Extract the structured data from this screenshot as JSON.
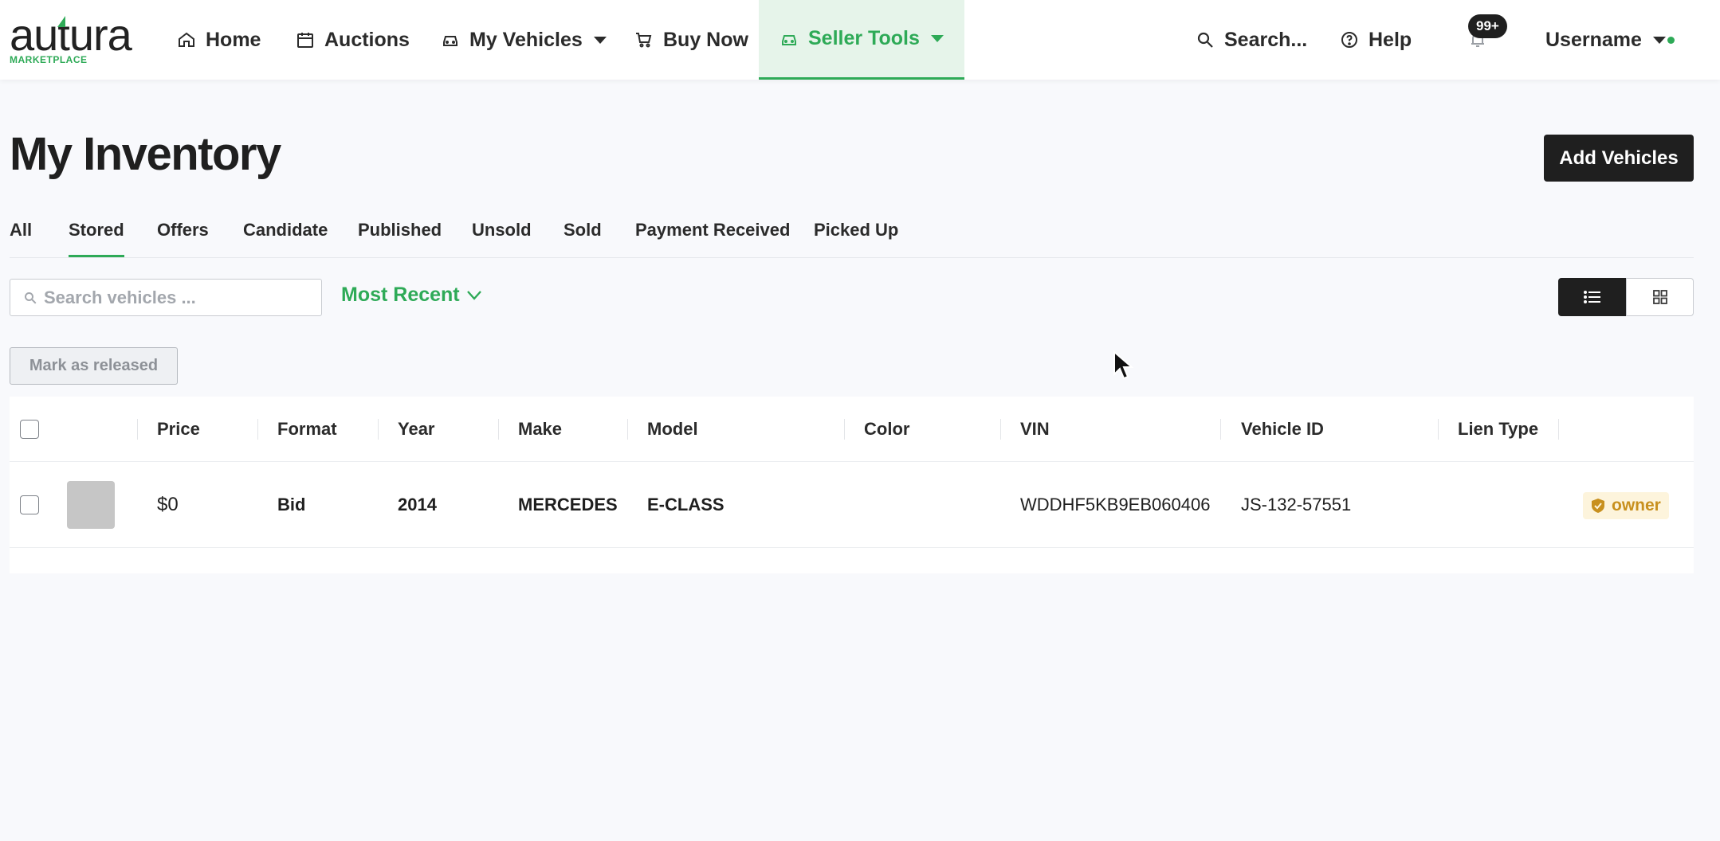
{
  "brand": {
    "name": "autura",
    "subtitle": "MARKETPLACE",
    "accent": "#2eaa57"
  },
  "nav": {
    "items": [
      {
        "label": "Home",
        "icon": "home-icon"
      },
      {
        "label": "Auctions",
        "icon": "calendar-icon"
      },
      {
        "label": "My Vehicles",
        "icon": "car-icon",
        "dropdown": true
      },
      {
        "label": "Buy Now",
        "icon": "cart-icon"
      },
      {
        "label": "Seller Tools",
        "icon": "car-icon",
        "dropdown": true,
        "active": true
      }
    ],
    "search_label": "Search...",
    "help_label": "Help",
    "notifications_count": "99+",
    "username": "Username"
  },
  "page": {
    "title": "My Inventory",
    "add_button": "Add Vehicles"
  },
  "tabs": [
    "All",
    "Stored",
    "Offers",
    "Candidate",
    "Published",
    "Unsold",
    "Sold",
    "Payment Received",
    "Picked Up"
  ],
  "active_tab": "Stored",
  "toolbar": {
    "search_placeholder": "Search vehicles ...",
    "sort_label": "Most Recent",
    "release_button": "Mark as released",
    "view_mode": "list"
  },
  "table": {
    "columns": [
      "Price",
      "Format",
      "Year",
      "Make",
      "Model",
      "Color",
      "VIN",
      "Vehicle ID",
      "Lien Type"
    ],
    "rows": [
      {
        "price": "$0",
        "format": "Bid",
        "year": "2014",
        "make": "MERCEDES",
        "model": "E-CLASS",
        "color": "",
        "vin": "WDDHF5KB9EB060406",
        "vehicle_id": "JS-132-57551",
        "lien_type": "",
        "role": "owner"
      }
    ]
  }
}
